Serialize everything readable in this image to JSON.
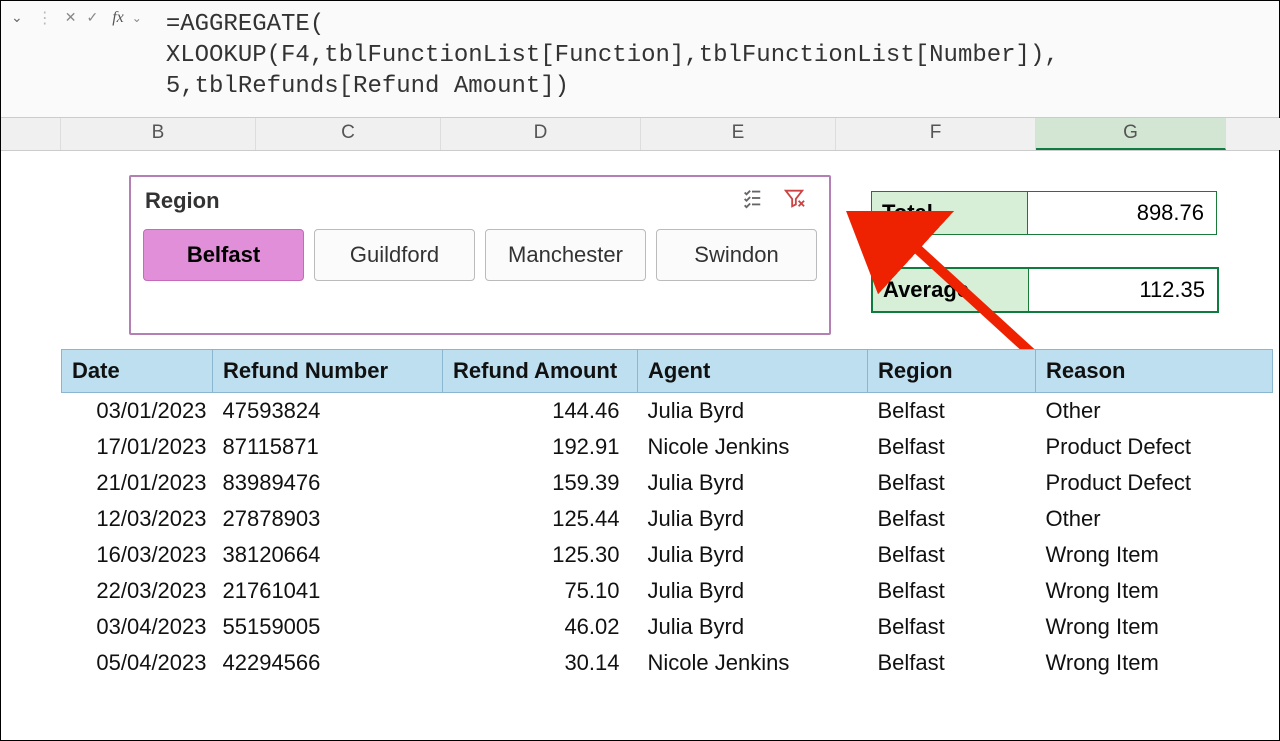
{
  "formula": {
    "line1": "=AGGREGATE(",
    "line2": "XLOOKUP(F4,tblFunctionList[Function],tblFunctionList[Number]),",
    "line3": "5,tblRefunds[Refund Amount])"
  },
  "columns": {
    "B": "B",
    "C": "C",
    "D": "D",
    "E": "E",
    "F": "F",
    "G": "G"
  },
  "slicer": {
    "title": "Region",
    "buttons": {
      "belfast": "Belfast",
      "guildford": "Guildford",
      "manchester": "Manchester",
      "swindon": "Swindon"
    }
  },
  "summary": {
    "total_label": "Total",
    "total_value": "898.76",
    "average_label": "Average",
    "average_value": "112.35"
  },
  "table": {
    "headers": {
      "date": "Date",
      "refnum": "Refund Number",
      "amount": "Refund Amount",
      "agent": "Agent",
      "region": "Region",
      "reason": "Reason"
    },
    "rows": [
      {
        "date": "03/01/2023",
        "refnum": "47593824",
        "amount": "144.46",
        "agent": "Julia Byrd",
        "region": "Belfast",
        "reason": "Other"
      },
      {
        "date": "17/01/2023",
        "refnum": "87115871",
        "amount": "192.91",
        "agent": "Nicole Jenkins",
        "region": "Belfast",
        "reason": "Product Defect"
      },
      {
        "date": "21/01/2023",
        "refnum": "83989476",
        "amount": "159.39",
        "agent": "Julia Byrd",
        "region": "Belfast",
        "reason": "Product Defect"
      },
      {
        "date": "12/03/2023",
        "refnum": "27878903",
        "amount": "125.44",
        "agent": "Julia Byrd",
        "region": "Belfast",
        "reason": "Other"
      },
      {
        "date": "16/03/2023",
        "refnum": "38120664",
        "amount": "125.30",
        "agent": "Julia Byrd",
        "region": "Belfast",
        "reason": "Wrong Item"
      },
      {
        "date": "22/03/2023",
        "refnum": "21761041",
        "amount": "75.10",
        "agent": "Julia Byrd",
        "region": "Belfast",
        "reason": "Wrong Item"
      },
      {
        "date": "03/04/2023",
        "refnum": "55159005",
        "amount": "46.02",
        "agent": "Julia Byrd",
        "region": "Belfast",
        "reason": "Wrong Item"
      },
      {
        "date": "05/04/2023",
        "refnum": "42294566",
        "amount": "30.14",
        "agent": "Nicole Jenkins",
        "region": "Belfast",
        "reason": "Wrong Item"
      }
    ]
  }
}
